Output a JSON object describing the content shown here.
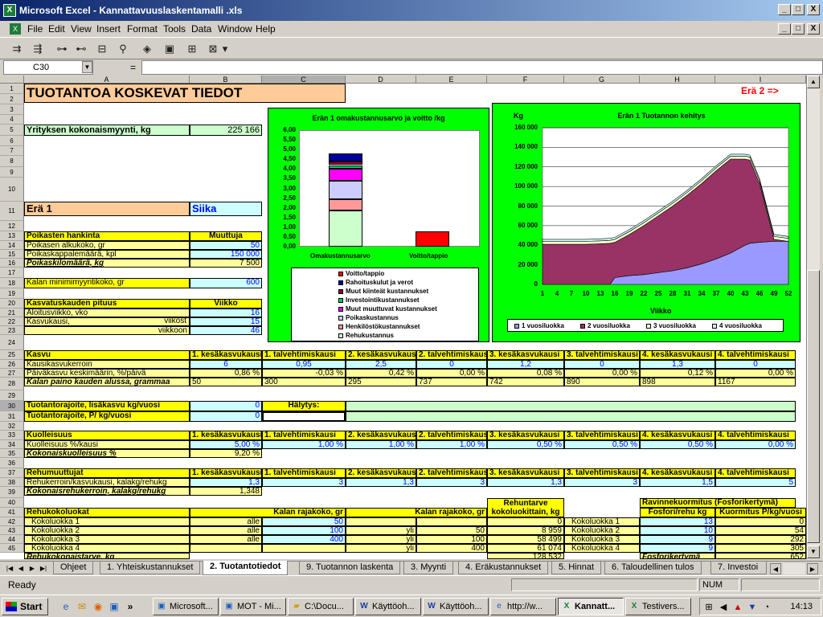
{
  "window": {
    "title": "Microsoft Excel - Kannattavuuslaskentamalli .xls",
    "btn_min": "_",
    "btn_max": "□",
    "btn_close": "X"
  },
  "menu": [
    "File",
    "Edit",
    "View",
    "Insert",
    "Format",
    "Tools",
    "Data",
    "Window",
    "Help"
  ],
  "namebox": {
    "value": "C30"
  },
  "formula": {
    "eq": "=",
    "value": ""
  },
  "columns": [
    "A",
    "B",
    "C",
    "D",
    "E",
    "F",
    "G",
    "H",
    "I"
  ],
  "rows": [
    "1",
    "2",
    "3",
    "4",
    "5",
    "6",
    "7",
    "8",
    "9",
    "10",
    "11",
    "12",
    "13",
    "14",
    "15",
    "16",
    "17",
    "18",
    "19",
    "20",
    "21",
    "22",
    "23",
    "24",
    "25",
    "26",
    "27",
    "28",
    "29",
    "30",
    "31",
    "32",
    "33",
    "34",
    "35",
    "36",
    "37",
    "38",
    "39",
    "40",
    "41",
    "42",
    "43",
    "44",
    "45"
  ],
  "sheet": {
    "title": "TUOTANTOA KOSKEVAT TIEDOT",
    "era2_link": "Erä 2 =>",
    "sales_label": "Yrityksen kokonaismyynti, kg",
    "sales_value": "225 166",
    "era_label": "Erä 1",
    "species": "Siika",
    "poikaset_header": "Poikasten hankinta",
    "muuttuja": "Muuttuja",
    "alkukoko_label": "Poikasen alkukoko, gr",
    "alkukoko_value": "50",
    "kpl_label": "Poikaskappalemäärä, kpl",
    "kpl_value": "150 000",
    "kilo_label": "Poikaskilomäärä, kg",
    "kilo_value": "7 500",
    "min_label": "Kalan minimimyyntikoko, gr",
    "min_value": "600",
    "kausi_label": "Kasvatuskauden pituus",
    "viikko": "Viikko",
    "aloitus_label": "Aloitusviikko, vko",
    "aloitus_value": "16",
    "kasvukausi_label": "Kasvukausi,",
    "viikost": "viikost",
    "kasvukausi_value": "15",
    "viikkoon": "viikkoon",
    "viikkoon_value": "46",
    "season_headers": [
      "1. kesäkasvukausi",
      "1. talvehtimiskausi",
      "2. kesäkasvukausi",
      "2. talvehtimiskausi",
      "3. kesäkasvukausi",
      "3. talvehtimiskausi",
      "4. kesäkasvukausi",
      "4. talvehtimiskausi"
    ],
    "kasvu_label": "Kasvu",
    "kerroin_label": "Kausikasvukerroin",
    "kerroin_values": [
      "6",
      "0,95",
      "2,5",
      "0",
      "1,2",
      "0",
      "1,3",
      "0"
    ],
    "paiva_label": "Päiväkasvu keskimäärin, %/päivä",
    "paiva_values": [
      "0,86 %",
      "-0,03 %",
      "0,42 %",
      "0,00 %",
      "0,08 %",
      "0,00 %",
      "0,12 %",
      "0,00 %"
    ],
    "paino_label": "Kalan paino kauden alussa, grammaa",
    "paino_values": [
      "50",
      "300",
      "295",
      "737",
      "742",
      "890",
      "898",
      "1167"
    ],
    "rajoite1_label": "Tuotantorajoite, lisäkasvu kg/vuosi",
    "rajoite1_value": "0",
    "halytys": "Hälytys:",
    "rajoite2_label": "Tuotantorajoite, P/ kg/vuosi",
    "rajoite2_value": "0",
    "kuolleisuus_label": "Kuolleisuus",
    "kuoll_kausi_label": "Kuolleisuus %/kausi",
    "kuoll_values": [
      "5,00 %",
      "1,00 %",
      "1,00 %",
      "1,00 %",
      "0,50 %",
      "0,50 %",
      "0,50 %",
      "0,00 %"
    ],
    "kok_kuoll_label": "Kokonaiskuolleisuus %",
    "kok_kuoll_value": "9,20 %",
    "rehu_label": "Rehumuuttujat",
    "rehukerroin_label": "Rehukerroin/kasvukausi, kalakg/rehukg",
    "rehukerroin_values": [
      "1,3",
      "3",
      "1,3",
      "3",
      "1,3",
      "3",
      "1,5",
      "5"
    ],
    "kok_rehu_label": "Kokonaisrehukerroin, kalakg/rehukg",
    "kok_rehu_value": "1,348",
    "rehuntarve_header": "Rehuntarve kokoluokittain, kg",
    "ravinne_header": "Ravinnekuormitus (Fosforikertymä)",
    "rehukoko_label": "Rehukokoluokat",
    "rajakoko1": "Kalan rajakoko, gr",
    "rajakoko2": "Kalan rajakoko, gr",
    "fosfori_header": "Fosfori/rehu kg",
    "kuormitus_header": "Kuormitus P/kg/vuosi",
    "kokoluokat": [
      {
        "label": "Kokoluokka 1",
        "op1": "alle",
        "v1": "50",
        "op2": "",
        "v2": "",
        "rehu": "0",
        "label2": "Kokoluokka 1",
        "fosf": "13",
        "kuorm": "0"
      },
      {
        "label": "Kokoluokka 2",
        "op1": "alle",
        "v1": "100",
        "op2": "yli",
        "v2": "50",
        "rehu": "8 959",
        "label2": "Kokoluokka 2",
        "fosf": "10",
        "kuorm": "54"
      },
      {
        "label": "Kokoluokka 3",
        "op1": "alle",
        "v1": "400",
        "op2": "yli",
        "v2": "100",
        "rehu": "58 499",
        "label2": "Kokoluokka 3",
        "fosf": "9",
        "kuorm": "292"
      },
      {
        "label": "Kokoluokka 4",
        "op1": "",
        "v1": "",
        "op2": "yli",
        "v2": "400",
        "rehu": "61 074",
        "label2": "Kokoluokka 4",
        "fosf": "9",
        "kuorm": "305"
      }
    ],
    "row45_a": "Rehukokonaistarve, kg",
    "row45_f": "128 532",
    "row45_h": "Fosforikertymä",
    "row45_i": "652"
  },
  "chart1": {
    "title": "Erän 1 omakustannusarvo ja voitto /kg",
    "y_ticks": [
      "6,00",
      "5,50",
      "5,00",
      "4,50",
      "4,00",
      "3,50",
      "3,00",
      "2,50",
      "2,00",
      "1,50",
      "1,00",
      "0,50",
      "0,00"
    ],
    "categories": [
      "Omakustannusarvo",
      "Voitto/tappio"
    ],
    "legend": [
      {
        "label": "Voitto/tappio",
        "color": "#ff0000"
      },
      {
        "label": "Rahoituskulut ja verot",
        "color": "#000099"
      },
      {
        "label": "Muut kiinteät kustannukset",
        "color": "#990033"
      },
      {
        "label": "Investointikustannukset",
        "color": "#00cc66"
      },
      {
        "label": "Muut muuttuvat kustannukset",
        "color": "#ff00ff"
      },
      {
        "label": "Poikaskustannus",
        "color": "#ccccff"
      },
      {
        "label": "Henkilöstökustannukset",
        "color": "#ff9999"
      },
      {
        "label": "Rehukustannus",
        "color": "#ccffcc"
      }
    ]
  },
  "chart2": {
    "title": "Erän 1 Tuotannon kehitys",
    "yunit": "Kg",
    "xlabel": "Viikko",
    "y_ticks": [
      "160 000",
      "140 000",
      "120 000",
      "100 000",
      "80 000",
      "60 000",
      "40 000",
      "20 000",
      "0"
    ],
    "x_ticks": [
      "1",
      "4",
      "7",
      "10",
      "13",
      "16",
      "19",
      "22",
      "25",
      "28",
      "31",
      "34",
      "37",
      "40",
      "43",
      "46",
      "49",
      "52"
    ],
    "legend": [
      {
        "label": "1 vuosiluokka",
        "color": "#9999ff"
      },
      {
        "label": "2 vuosiluokka",
        "color": "#993366"
      },
      {
        "label": "3 vuosiluokka",
        "color": "#ffffcc"
      },
      {
        "label": "4 vuosiluokka",
        "color": "#ccffff"
      }
    ]
  },
  "chart_data": [
    {
      "type": "bar",
      "title": "Erän 1 omakustannusarvo ja voitto /kg",
      "categories": [
        "Omakustannusarvo",
        "Voitto/tappio"
      ],
      "ylim": [
        0,
        6
      ],
      "series": [
        {
          "name": "Rehukustannus",
          "values": [
            1.85,
            0
          ]
        },
        {
          "name": "Henkilöstökustannukset",
          "values": [
            0.6,
            0
          ]
        },
        {
          "name": "Poikaskustannus",
          "values": [
            0.95,
            0
          ]
        },
        {
          "name": "Muut muuttuvat kustannukset",
          "values": [
            0.6,
            0
          ]
        },
        {
          "name": "Investointikustannukset",
          "values": [
            0.2,
            0
          ]
        },
        {
          "name": "Muut kiinteät kustannukset",
          "values": [
            0.2,
            0
          ]
        },
        {
          "name": "Rahoituskulut ja verot",
          "values": [
            0.4,
            0
          ]
        },
        {
          "name": "Voitto/tappio",
          "values": [
            0,
            0.8
          ]
        }
      ]
    },
    {
      "type": "area",
      "title": "Erän 1 Tuotannon kehitys",
      "ylabel": "Kg",
      "xlabel": "Viikko",
      "ylim": [
        0,
        160000
      ],
      "x": [
        1,
        4,
        7,
        10,
        13,
        15,
        16,
        19,
        22,
        25,
        28,
        31,
        34,
        37,
        40,
        43,
        44,
        46,
        49,
        52
      ],
      "series": [
        {
          "name": "1 vuosiluokka",
          "values": [
            0,
            0,
            0,
            0,
            0,
            0,
            7000,
            9000,
            10000,
            12000,
            14000,
            17000,
            21000,
            26000,
            32000,
            40000,
            42000,
            43000,
            44000,
            44000
          ]
        },
        {
          "name": "2 vuosiluokka",
          "values": [
            41000,
            41000,
            41000,
            41000,
            41500,
            42000,
            36000,
            42000,
            50000,
            58000,
            66000,
            74000,
            82000,
            90000,
            96000,
            88000,
            85000,
            60000,
            2000,
            0
          ]
        },
        {
          "name": "3 vuosiluokka",
          "values": [
            3000,
            3000,
            3000,
            3000,
            3000,
            3000,
            3000,
            3000,
            3000,
            3000,
            3000,
            3000,
            3000,
            3000,
            3000,
            3000,
            3000,
            3000,
            3000,
            3000
          ]
        },
        {
          "name": "4 vuosiluokka",
          "values": [
            2000,
            2000,
            2000,
            2000,
            2000,
            2000,
            2000,
            2000,
            2000,
            2000,
            2000,
            2000,
            2000,
            2000,
            2000,
            2000,
            2000,
            2000,
            2000,
            2000
          ]
        }
      ]
    }
  ],
  "tabs": [
    "Ohjeet",
    "1. Yhteiskustannukset",
    "2. Tuotantotiedot",
    "9. Tuotannon laskenta",
    "3. Myynti",
    "4. Eräkustannukset",
    "5. Hinnat",
    "6. Taloudellinen tulos",
    "7. Investoi"
  ],
  "status": {
    "ready": "Ready",
    "num": "NUM"
  },
  "taskbar": {
    "start": "Start",
    "tasks": [
      "Microsoft...",
      "MOT - Mi...",
      "C:\\Docu...",
      "Käyttöoh...",
      "Käyttöoh...",
      "http://w...",
      "Kannatt...",
      "Testivers..."
    ],
    "clock": "14:13"
  }
}
